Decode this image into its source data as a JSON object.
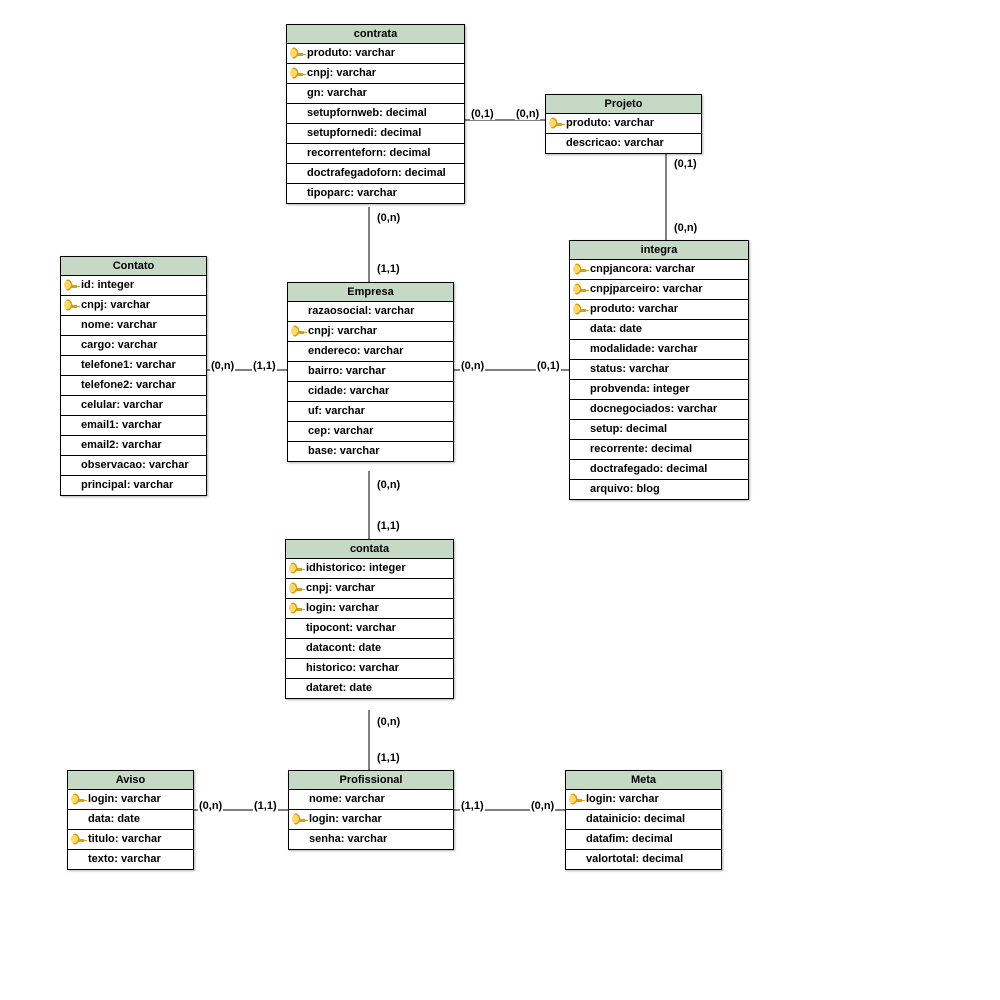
{
  "entities": {
    "contrata": {
      "title": "contrata",
      "attrs": [
        [
          "produto: varchar",
          1
        ],
        [
          "cnpj: varchar",
          1
        ],
        [
          "gn: varchar",
          0
        ],
        [
          "setupfornweb: decimal",
          0
        ],
        [
          "setupfornedi: decimal",
          0
        ],
        [
          "recorrenteforn: decimal",
          0
        ],
        [
          "doctrafegadoforn: decimal",
          0
        ],
        [
          "tipoparc: varchar",
          0
        ]
      ]
    },
    "projeto": {
      "title": "Projeto",
      "attrs": [
        [
          "produto: varchar",
          1
        ],
        [
          "descricao: varchar",
          0
        ]
      ]
    },
    "contato": {
      "title": "Contato",
      "attrs": [
        [
          "id: integer",
          1
        ],
        [
          "cnpj: varchar",
          1
        ],
        [
          "nome: varchar",
          0
        ],
        [
          "cargo: varchar",
          0
        ],
        [
          "telefone1: varchar",
          0
        ],
        [
          "telefone2: varchar",
          0
        ],
        [
          "celular: varchar",
          0
        ],
        [
          "email1: varchar",
          0
        ],
        [
          "email2: varchar",
          0
        ],
        [
          "observacao: varchar",
          0
        ],
        [
          "principal: varchar",
          0
        ]
      ]
    },
    "empresa": {
      "title": "Empresa",
      "attrs": [
        [
          "razaosocial: varchar",
          0
        ],
        [
          "cnpj: varchar",
          1
        ],
        [
          "endereco: varchar",
          0
        ],
        [
          "bairro: varchar",
          0
        ],
        [
          "cidade: varchar",
          0
        ],
        [
          "uf: varchar",
          0
        ],
        [
          "cep: varchar",
          0
        ],
        [
          "base: varchar",
          0
        ]
      ]
    },
    "integra": {
      "title": "integra",
      "attrs": [
        [
          "cnpjancora: varchar",
          1
        ],
        [
          "cnpjparceiro: varchar",
          1
        ],
        [
          "produto: varchar",
          1
        ],
        [
          "data: date",
          0
        ],
        [
          "modalidade: varchar",
          0
        ],
        [
          "status: varchar",
          0
        ],
        [
          "probvenda: integer",
          0
        ],
        [
          "docnegociados: varchar",
          0
        ],
        [
          "setup: decimal",
          0
        ],
        [
          "recorrente: decimal",
          0
        ],
        [
          "doctrafegado: decimal",
          0
        ],
        [
          "arquivo: blog",
          0
        ]
      ]
    },
    "contata": {
      "title": "contata",
      "attrs": [
        [
          "idhistorico: integer",
          1
        ],
        [
          "cnpj: varchar",
          1
        ],
        [
          "login: varchar",
          1
        ],
        [
          "tipocont: varchar",
          0
        ],
        [
          "datacont: date",
          0
        ],
        [
          "historico: varchar",
          0
        ],
        [
          "dataret: date",
          0
        ]
      ]
    },
    "aviso": {
      "title": "Aviso",
      "attrs": [
        [
          "login: varchar",
          1
        ],
        [
          "data: date",
          0
        ],
        [
          "titulo: varchar",
          1
        ],
        [
          "texto: varchar",
          0
        ]
      ]
    },
    "profissional": {
      "title": "Profissional",
      "attrs": [
        [
          "nome: varchar",
          0
        ],
        [
          "login: varchar",
          1
        ],
        [
          "senha: varchar",
          0
        ]
      ]
    },
    "meta": {
      "title": "Meta",
      "attrs": [
        [
          "login: varchar",
          1
        ],
        [
          "datainicio: decimal",
          0
        ],
        [
          "datafim: decimal",
          0
        ],
        [
          "valortotal: decimal",
          0
        ]
      ]
    }
  },
  "cards": {
    "c1": "(0,1)",
    "c2": "(0,n)",
    "c3": "(0,n)",
    "c4": "(1,1)",
    "c5": "(0,n)",
    "c6": "(1,1)",
    "c7": "(0,n)",
    "c8": "(0,1)",
    "c9": "(0,1)",
    "c10": "(0,n)",
    "c11": "(0,n)",
    "c12": "(1,1)",
    "c13": "(0,n)",
    "c14": "(1,1)",
    "c15": "(0,n)",
    "c16": "(1,1)",
    "c17": "(1,1)",
    "c18": "(0,n)"
  }
}
